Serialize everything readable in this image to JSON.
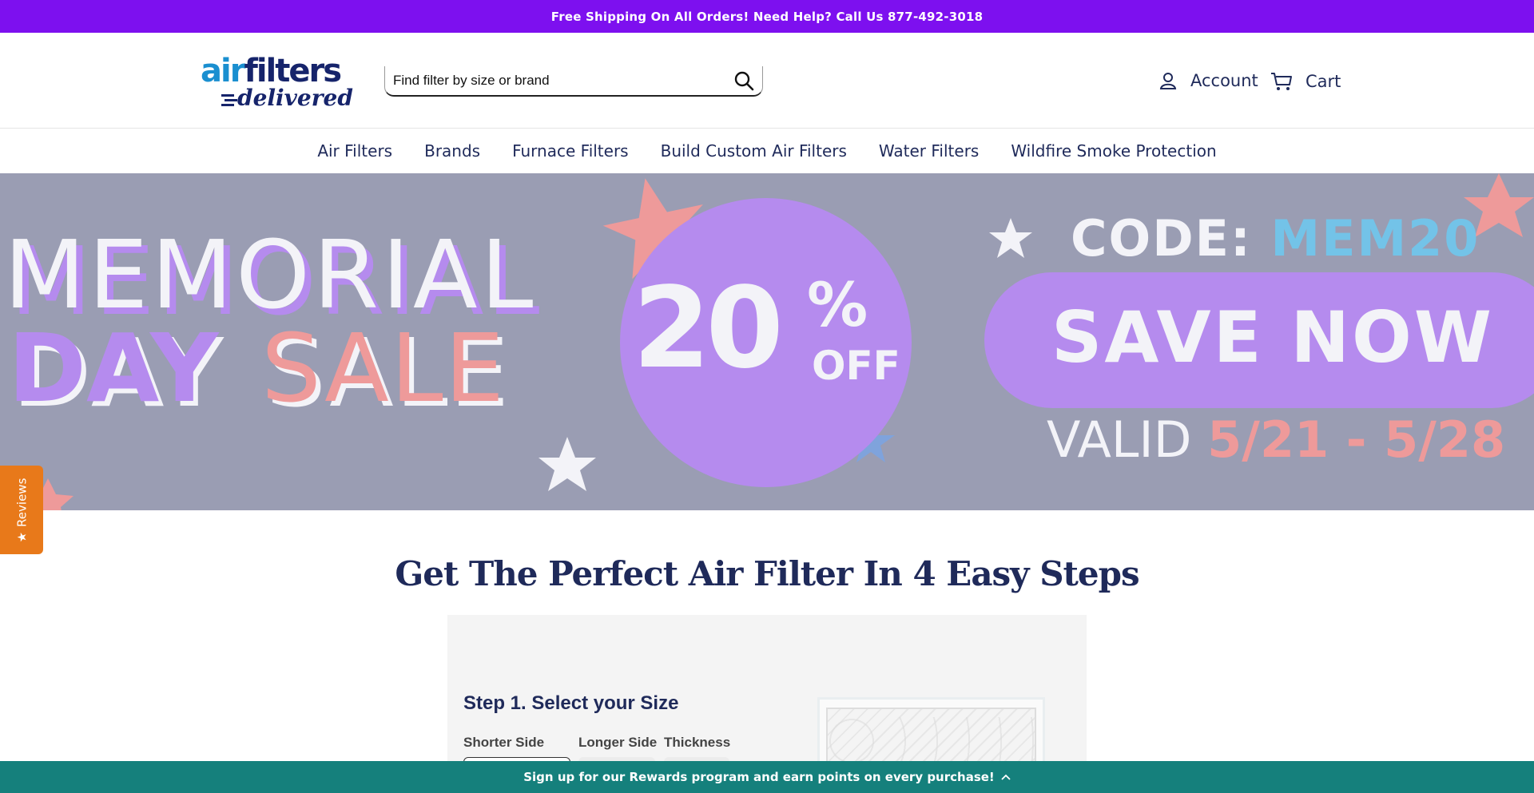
{
  "announcement": {
    "text": "Free Shipping On All Orders! Need Help? Call Us 877-492-3018"
  },
  "logo": {
    "part1": "air",
    "part2": "filters",
    "part3": "delivered"
  },
  "search": {
    "placeholder": "Find filter by size or brand"
  },
  "header": {
    "account_label": "Account",
    "cart_label": "Cart"
  },
  "nav": {
    "items": [
      "Air Filters",
      "Brands",
      "Furnace Filters",
      "Build Custom Air Filters",
      "Water Filters",
      "Wildfire Smoke Protection"
    ]
  },
  "hero": {
    "memorial": "MEMORIAL",
    "day": "DAY",
    "sale": "SALE",
    "discount": "20",
    "percent": "%",
    "off": "OFF",
    "code_label": "CODE:",
    "code_value": "MEM20",
    "cta": "SAVE NOW",
    "valid_label": "VALID",
    "valid_dates": "5/21 - 5/28",
    "colors": {
      "background": "#9a9db3",
      "purple": "#b58bee",
      "pink": "#ee9a9a",
      "blue": "#73c3e8"
    }
  },
  "reviews_tab": {
    "label": "Reviews",
    "icon": "star-icon"
  },
  "finder": {
    "title": "Get The Perfect Air Filter In 4 Easy Steps",
    "step1_title": "Step 1. Select your Size",
    "columns": [
      "Shorter Side",
      "Longer Side",
      "Thickness"
    ]
  },
  "rewards_bar": {
    "text": "Sign up for our Rewards program and earn points on every purchase!",
    "icon": "chevron-up-icon"
  },
  "colors": {
    "announcement_bg": "#7d10ef",
    "rewards_bg": "#15807c",
    "reviews_bg": "#e8791a",
    "brand_navy": "#1f2a5a"
  }
}
